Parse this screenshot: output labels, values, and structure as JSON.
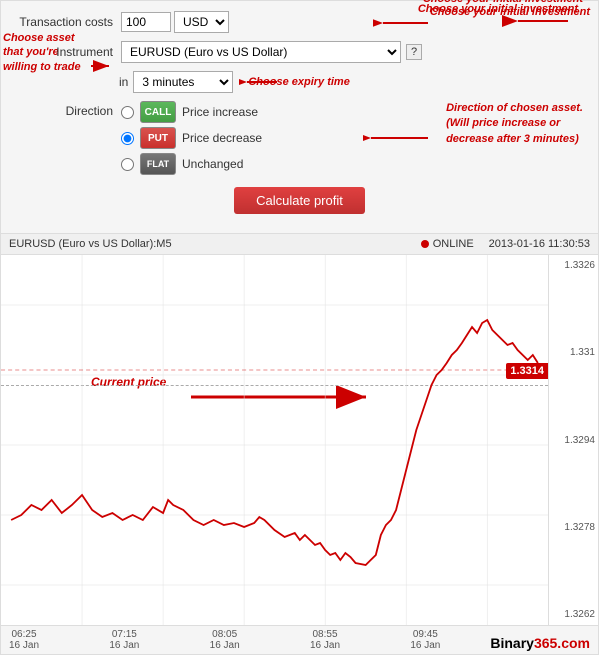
{
  "top_panel": {
    "transaction_label": "Transaction costs",
    "amount_value": "100",
    "currency": "USD",
    "instrument_label": "Instrument",
    "instrument_value": "EURUSD (Euro vs US Dollar)",
    "in_label": "in",
    "expiry_value": "3 minutes",
    "direction_label": "Direction",
    "direction_options": [
      {
        "id": "dir-increase",
        "label": "Price increase",
        "btn": "CALL",
        "type": "call",
        "checked": false
      },
      {
        "id": "dir-decrease",
        "label": "Price decrease",
        "btn": "PUT",
        "type": "put",
        "checked": true
      },
      {
        "id": "dir-unchanged",
        "label": "Unchanged",
        "btn": "FLAT",
        "type": "flat",
        "checked": false
      }
    ],
    "calculate_btn": "Calculate profit",
    "annotations": {
      "asset": "Choose asset\nthat you're\nwilling to trade",
      "investment": "Choose your initial investment",
      "expiry": "Choose expiry time",
      "direction": "Direction of chosen asset.\n(Will price increase or\ndecrease after 3 minutes)"
    }
  },
  "chart": {
    "title": "EURUSD (Euro vs US Dollar):M5",
    "status": "ONLINE",
    "timestamp": "2013-01-16  11:30:53",
    "current_price": "1.3314",
    "y_labels": [
      "1.3326",
      "1.331",
      "1.3294",
      "1.3278",
      "1.3262"
    ],
    "x_labels": [
      {
        "time": "06:25",
        "date": "16 Jan"
      },
      {
        "time": "07:15",
        "date": "16 Jan"
      },
      {
        "time": "08:05",
        "date": "16 Jan"
      },
      {
        "time": "08:55",
        "date": "16 Jan"
      },
      {
        "time": "09:45",
        "date": "16 Jan"
      }
    ],
    "watermark": "Binary365.com",
    "watermark_color": "Binary",
    "annotation_current_price": "Current price"
  }
}
